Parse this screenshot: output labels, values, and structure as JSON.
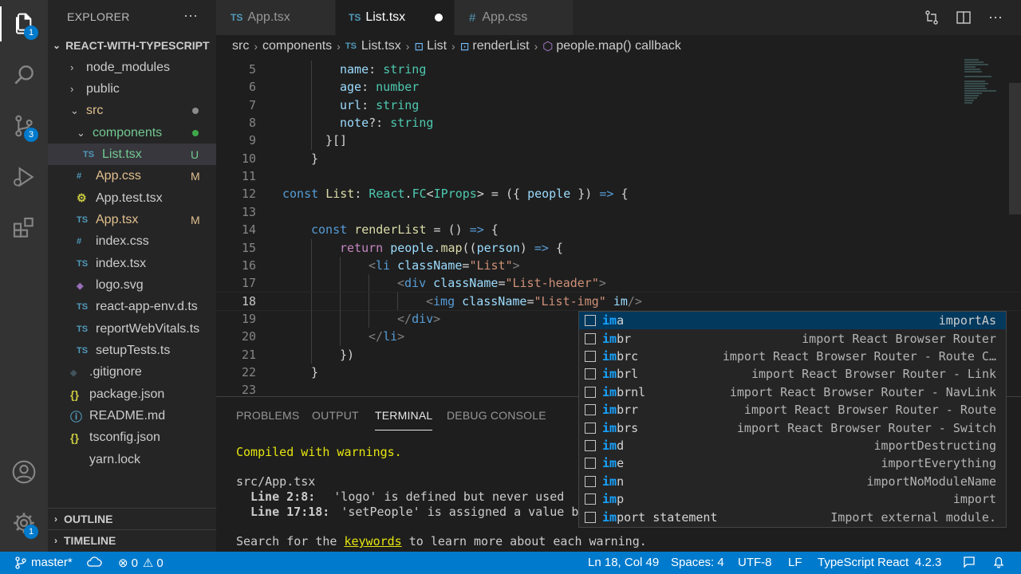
{
  "colors": {
    "accent": "#007acc",
    "activity_bar": "#333333",
    "sidebar": "#252526",
    "editor": "#1e1e1e",
    "suggest_selected": "#04395e"
  },
  "activity": {
    "explorer_badge": "1",
    "scm_badge": "3",
    "manage_badge": "1"
  },
  "sidebar": {
    "title": "EXPLORER",
    "more": "···",
    "project": "REACT-WITH-TYPESCRIPT",
    "items": [
      {
        "label": "node_modules",
        "kind": "folder",
        "depth": 1,
        "open": false
      },
      {
        "label": "public",
        "kind": "folder",
        "depth": 1,
        "open": false
      },
      {
        "label": "src",
        "kind": "folder",
        "depth": 1,
        "open": true,
        "status_dot": "#8b8b8b"
      },
      {
        "label": "components",
        "kind": "folder",
        "depth": 2,
        "open": true,
        "status_dot": "#3ea84a"
      },
      {
        "label": "List.tsx",
        "kind": "ts",
        "depth": 3,
        "status": "U"
      },
      {
        "label": "App.css",
        "kind": "css",
        "depth": 2,
        "status": "M"
      },
      {
        "label": "App.test.tsx",
        "kind": "test",
        "depth": 2
      },
      {
        "label": "App.tsx",
        "kind": "ts",
        "depth": 2,
        "status": "M"
      },
      {
        "label": "index.css",
        "kind": "css",
        "depth": 2
      },
      {
        "label": "index.tsx",
        "kind": "ts",
        "depth": 2
      },
      {
        "label": "logo.svg",
        "kind": "svg",
        "depth": 2
      },
      {
        "label": "react-app-env.d.ts",
        "kind": "ts",
        "depth": 2
      },
      {
        "label": "reportWebVitals.ts",
        "kind": "ts",
        "depth": 2
      },
      {
        "label": "setupTests.ts",
        "kind": "ts",
        "depth": 2
      },
      {
        "label": ".gitignore",
        "kind": "git",
        "depth": 1
      },
      {
        "label": "package.json",
        "kind": "json",
        "depth": 1
      },
      {
        "label": "README.md",
        "kind": "info",
        "depth": 1
      },
      {
        "label": "tsconfig.json",
        "kind": "json",
        "depth": 1
      },
      {
        "label": "yarn.lock",
        "kind": "lock",
        "depth": 1
      }
    ],
    "outline": "OUTLINE",
    "timeline": "TIMELINE"
  },
  "tabs": [
    {
      "prefix": "TS",
      "label": "App.tsx",
      "active": false
    },
    {
      "prefix": "TS",
      "label": "List.tsx",
      "active": true,
      "dirty": true
    },
    {
      "prefix": "#",
      "label": "App.css",
      "active": false
    }
  ],
  "breadcrumb": {
    "parts": [
      "src",
      "components",
      "List.tsx",
      "List",
      "renderList",
      "people.map() callback"
    ],
    "file_prefix": "TS"
  },
  "editor": {
    "lines": [
      {
        "n": "5",
        "indent": 4,
        "tokens": [
          [
            "v",
            "name"
          ],
          [
            "p",
            ": "
          ],
          [
            "t",
            "string"
          ]
        ]
      },
      {
        "n": "6",
        "indent": 4,
        "tokens": [
          [
            "v",
            "age"
          ],
          [
            "p",
            ": "
          ],
          [
            "t",
            "number"
          ]
        ]
      },
      {
        "n": "7",
        "indent": 4,
        "tokens": [
          [
            "v",
            "url"
          ],
          [
            "p",
            ": "
          ],
          [
            "t",
            "string"
          ]
        ]
      },
      {
        "n": "8",
        "indent": 4,
        "tokens": [
          [
            "v",
            "note"
          ],
          [
            "p",
            "?: "
          ],
          [
            "t",
            "string"
          ]
        ]
      },
      {
        "n": "9",
        "indent": 3,
        "tokens": [
          [
            "p",
            "}[]"
          ]
        ]
      },
      {
        "n": "10",
        "indent": 2,
        "tokens": [
          [
            "p",
            "}"
          ]
        ]
      },
      {
        "n": "11",
        "indent": 0,
        "tokens": []
      },
      {
        "n": "12",
        "indent": 0,
        "tokens": [
          [
            "k",
            "const "
          ],
          [
            "f",
            "List"
          ],
          [
            "p",
            ": "
          ],
          [
            "t",
            "React"
          ],
          [
            "p",
            "."
          ],
          [
            "t",
            "FC"
          ],
          [
            "p",
            "<"
          ],
          [
            "t",
            "IProps"
          ],
          [
            "p",
            "> = ({ "
          ],
          [
            "v",
            "people"
          ],
          [
            "p",
            " }) "
          ],
          [
            "k",
            "=>"
          ],
          [
            "p",
            " {"
          ]
        ]
      },
      {
        "n": "13",
        "indent": 0,
        "tokens": []
      },
      {
        "n": "14",
        "indent": 2,
        "tokens": [
          [
            "k",
            "const "
          ],
          [
            "f",
            "renderList"
          ],
          [
            "p",
            " = () "
          ],
          [
            "k",
            "=>"
          ],
          [
            "p",
            " {"
          ]
        ]
      },
      {
        "n": "15",
        "indent": 4,
        "tokens": [
          [
            "kc",
            "return "
          ],
          [
            "v",
            "people"
          ],
          [
            "p",
            "."
          ],
          [
            "f",
            "map"
          ],
          [
            "p",
            "(("
          ],
          [
            "v",
            "person"
          ],
          [
            "p",
            ") "
          ],
          [
            "k",
            "=>"
          ],
          [
            "p",
            " {"
          ]
        ]
      },
      {
        "n": "16",
        "indent": 6,
        "tokens": [
          [
            "tg",
            "<"
          ],
          [
            "bl",
            "li"
          ],
          [
            "p",
            " "
          ],
          [
            "v",
            "className"
          ],
          [
            "p",
            "="
          ],
          [
            "s",
            "\"List\""
          ],
          [
            "tg",
            ">"
          ]
        ]
      },
      {
        "n": "17",
        "indent": 8,
        "tokens": [
          [
            "tg",
            "<"
          ],
          [
            "bl",
            "div"
          ],
          [
            "p",
            " "
          ],
          [
            "v",
            "className"
          ],
          [
            "p",
            "="
          ],
          [
            "s",
            "\"List-header\""
          ],
          [
            "tg",
            ">"
          ]
        ]
      },
      {
        "n": "18",
        "indent": 10,
        "tokens": [
          [
            "tg",
            "<"
          ],
          [
            "bl",
            "img"
          ],
          [
            "p",
            " "
          ],
          [
            "v",
            "className"
          ],
          [
            "p",
            "="
          ],
          [
            "s",
            "\"List-img\""
          ],
          [
            "p",
            " "
          ],
          [
            "v",
            "im"
          ],
          [
            "tg",
            "/>"
          ]
        ],
        "current": true
      },
      {
        "n": "19",
        "indent": 8,
        "tokens": [
          [
            "tg",
            "</"
          ],
          [
            "bl",
            "div"
          ],
          [
            "tg",
            ">"
          ]
        ]
      },
      {
        "n": "20",
        "indent": 6,
        "tokens": [
          [
            "tg",
            "</"
          ],
          [
            "bl",
            "li"
          ],
          [
            "tg",
            ">"
          ]
        ]
      },
      {
        "n": "21",
        "indent": 4,
        "tokens": [
          [
            "p",
            "})"
          ]
        ]
      },
      {
        "n": "22",
        "indent": 2,
        "tokens": [
          [
            "p",
            "}"
          ]
        ]
      },
      {
        "n": "23",
        "indent": 0,
        "tokens": []
      }
    ]
  },
  "suggest": [
    {
      "match": "im",
      "rest": "a",
      "detail": "importAs",
      "selected": true
    },
    {
      "match": "im",
      "rest": "br",
      "detail": "import React Browser Router"
    },
    {
      "match": "im",
      "rest": "brc",
      "detail": "import React Browser Router - Route C…"
    },
    {
      "match": "im",
      "rest": "brl",
      "detail": "import React Browser Router - Link"
    },
    {
      "match": "im",
      "rest": "brnl",
      "detail": "import React Browser Router - NavLink"
    },
    {
      "match": "im",
      "rest": "brr",
      "detail": "import React Browser Router - Route"
    },
    {
      "match": "im",
      "rest": "brs",
      "detail": "import React Browser Router - Switch"
    },
    {
      "match": "im",
      "rest": "d",
      "detail": "importDestructing"
    },
    {
      "match": "im",
      "rest": "e",
      "detail": "importEverything"
    },
    {
      "match": "im",
      "rest": "n",
      "detail": "importNoModuleName"
    },
    {
      "match": "im",
      "rest": "p",
      "detail": "import"
    },
    {
      "match": "im",
      "rest": "port statement",
      "detail": "Import external module."
    }
  ],
  "panel": {
    "tabs": [
      "PROBLEMS",
      "OUTPUT",
      "TERMINAL",
      "DEBUG CONSOLE"
    ],
    "active_tab": "TERMINAL",
    "compiled": "Compiled with warnings.",
    "file": "src/App.tsx",
    "warn1_loc": "Line 2:8:",
    "warn1_msg": "'logo' is defined but never used",
    "warn2_loc": "Line 17:18:",
    "warn2_msg": "'setPeople' is assigned a value bu",
    "search_pre": "Search for the ",
    "search_kw": "keywords",
    "search_post": " to learn more about each warning."
  },
  "status": {
    "branch": "master*",
    "errors": "0",
    "warnings": "0",
    "position": "Ln 18, Col 49",
    "spaces": "Spaces: 4",
    "encoding": "UTF-8",
    "eol": "LF",
    "language": "TypeScript React",
    "version": "4.2.3"
  }
}
